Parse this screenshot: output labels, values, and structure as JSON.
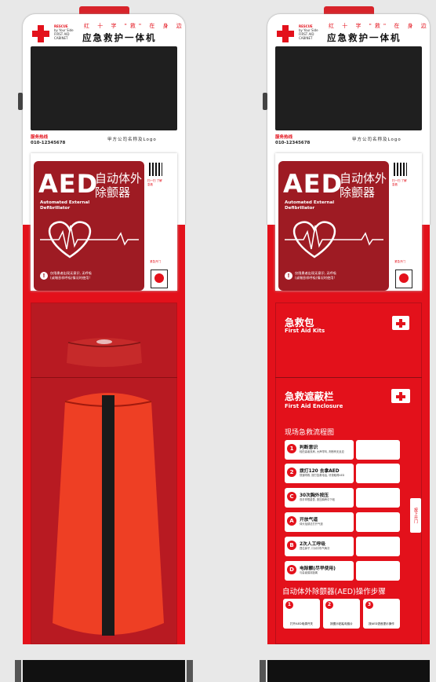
{
  "header": {
    "logo_en": [
      "RESCUE",
      "by Your Side",
      "FIRST AID",
      "CABINET"
    ],
    "slogan": "红 十 字 \"救\" 在 身 边",
    "title": "应急救护一体机"
  },
  "service": {
    "hotline_label": "服务热线",
    "phone": "010-12345678",
    "company": "甲方公司名称及Logo"
  },
  "aed_panel": {
    "big": "AED",
    "en_line1": "Automated External",
    "en_line2": "Defibrillator",
    "cn": "自动体外除颤器",
    "warning_line1": "仅限患者出现无意识, 无呼吸",
    "warning_line2": "(或喘息样呼吸)情况时使用!",
    "qr_text": "扫一扫 了解急救",
    "push_label": "紧急开门"
  },
  "kit": {
    "title": "急救包",
    "en": "First Aid Kits"
  },
  "enclosure": {
    "title": "急救遮蔽栏",
    "en": "First Aid Enclosure"
  },
  "flow": {
    "title": "现场急救流程图",
    "side_tag": "按下开门",
    "steps": [
      {
        "badge": "1",
        "title": "判断意识",
        "sub": "轻拍患者双肩, 大声呼叫, 判断有无反应"
      },
      {
        "badge": "2",
        "title": "拨打120 去拿AED",
        "sub": "快速呼救, 拨打急救电话, 尽快取得AED"
      },
      {
        "badge": "C",
        "title": "30次胸外按压",
        "sub": "双手掌根重叠, 按压胸骨中下段"
      },
      {
        "badge": "A",
        "title": "开放气道",
        "sub": "仰头抬颏法打开气道"
      },
      {
        "badge": "B",
        "title": "2次人工呼吸",
        "sub": "捏住鼻子, 口对口吹气两次"
      },
      {
        "badge": "D",
        "title": "电除颤(尽早使用)",
        "sub": "与患者保持距离"
      }
    ]
  },
  "aed_ops": {
    "title": "自动体外除颤器(AED)操作步骤",
    "steps": [
      {
        "n": "1",
        "text": "打开AED电源开关"
      },
      {
        "n": "2",
        "text": "按图示贴粘电极片"
      },
      {
        "n": "3",
        "text": "按AED语音提示操作"
      }
    ]
  },
  "colors": {
    "brand_red": "#e3111b",
    "panel_red": "#9e1b23"
  }
}
